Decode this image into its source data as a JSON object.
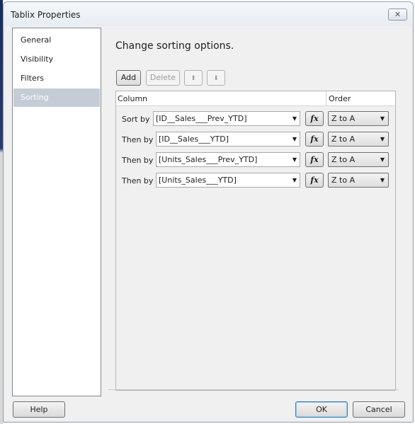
{
  "window": {
    "title": "Tablix Properties"
  },
  "nav": {
    "items": [
      {
        "label": "General"
      },
      {
        "label": "Visibility"
      },
      {
        "label": "Filters"
      },
      {
        "label": "Sorting"
      }
    ],
    "selected": "Sorting"
  },
  "main": {
    "heading": "Change sorting options.",
    "toolbar": {
      "add_label": "Add",
      "delete_label": "Delete"
    },
    "grid": {
      "column_header": "Column",
      "order_header": "Order",
      "rows": [
        {
          "label": "Sort by",
          "column": "[ID__Sales___Prev_YTD]",
          "order": "Z to A"
        },
        {
          "label": "Then by",
          "column": "[ID__Sales___YTD]",
          "order": "Z to A"
        },
        {
          "label": "Then by",
          "column": "[Units_Sales___Prev_YTD]",
          "order": "Z to A"
        },
        {
          "label": "Then by",
          "column": "[Units_Sales___YTD]",
          "order": "Z to A"
        }
      ]
    }
  },
  "footer": {
    "help_label": "Help",
    "ok_label": "OK",
    "cancel_label": "Cancel"
  },
  "icons": {
    "close": "close-icon",
    "move_up": "arrow-up-icon",
    "move_down": "arrow-down-icon",
    "expression": "fx-icon",
    "dropdown": "chevron-down-icon"
  }
}
